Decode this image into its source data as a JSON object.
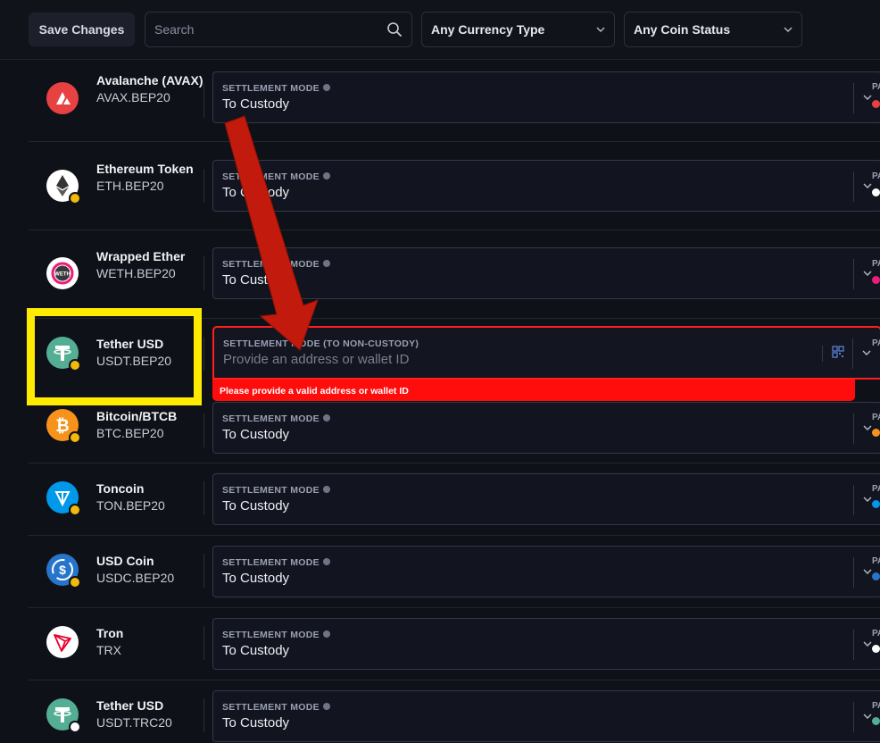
{
  "toolbar": {
    "save_label": "Save Changes",
    "search_placeholder": "Search",
    "currency_filter": "Any Currency Type",
    "status_filter": "Any Coin Status"
  },
  "field_label": "SETTLEMENT MODE",
  "rows": [
    {
      "name": "Avalanche (AVAX)",
      "symbol": "AVAX.BEP20",
      "mode_label": "SETTLEMENT MODE",
      "mode_value": "To Custody",
      "peek": "PA"
    },
    {
      "name": "Ethereum Token",
      "symbol": "ETH.BEP20",
      "mode_label": "SETTLEMENT MODE",
      "mode_value": "To Custody",
      "peek": "PA"
    },
    {
      "name": "Wrapped Ether",
      "symbol": "WETH.BEP20",
      "mode_label": "SETTLEMENT MODE",
      "mode_value": "To Custody",
      "peek": "PA"
    },
    {
      "name": "Tether USD",
      "symbol": "USDT.BEP20",
      "mode_label": "SETTLEMENT MODE (TO NON-CUSTODY)",
      "mode_value": "Provide an address or wallet ID",
      "error": "Please provide a valid address or wallet ID",
      "peek": "PA"
    },
    {
      "name": "Bitcoin/BTCB",
      "symbol": "BTC.BEP20",
      "mode_label": "SETTLEMENT MODE",
      "mode_value": "To Custody",
      "peek": "PA"
    },
    {
      "name": "Toncoin",
      "symbol": "TON.BEP20",
      "mode_label": "SETTLEMENT MODE",
      "mode_value": "To Custody",
      "peek": "PA"
    },
    {
      "name": "USD Coin",
      "symbol": "USDC.BEP20",
      "mode_label": "SETTLEMENT MODE",
      "mode_value": "To Custody",
      "peek": "PA"
    },
    {
      "name": "Tron",
      "symbol": "TRX",
      "mode_label": "SETTLEMENT MODE",
      "mode_value": "To Custody",
      "peek": "PA"
    },
    {
      "name": "Tether USD",
      "symbol": "USDT.TRC20",
      "mode_label": "SETTLEMENT MODE",
      "mode_value": "To Custody",
      "peek": "PA"
    }
  ],
  "colors": {
    "avax": "#e84142",
    "eth": "#ffffff",
    "weth": "#ffffff",
    "usdt": "#53ae94",
    "btc": "#f7931a",
    "ton": "#0098ea",
    "usdc": "#2775ca",
    "tron": "#ffffff",
    "bep_badge": "#f0b90b",
    "error": "#ff0d0d",
    "highlight": "#ffeb00",
    "arrow": "#c21a0c"
  },
  "icons": [
    "search-icon",
    "chevron-down-icon",
    "info-icon",
    "qr-code-icon",
    "avalanche-logo",
    "ethereum-logo",
    "weth-logo",
    "tether-logo",
    "bitcoin-logo",
    "toncoin-logo",
    "usdc-logo",
    "tron-logo",
    "bnb-badge-icon"
  ]
}
